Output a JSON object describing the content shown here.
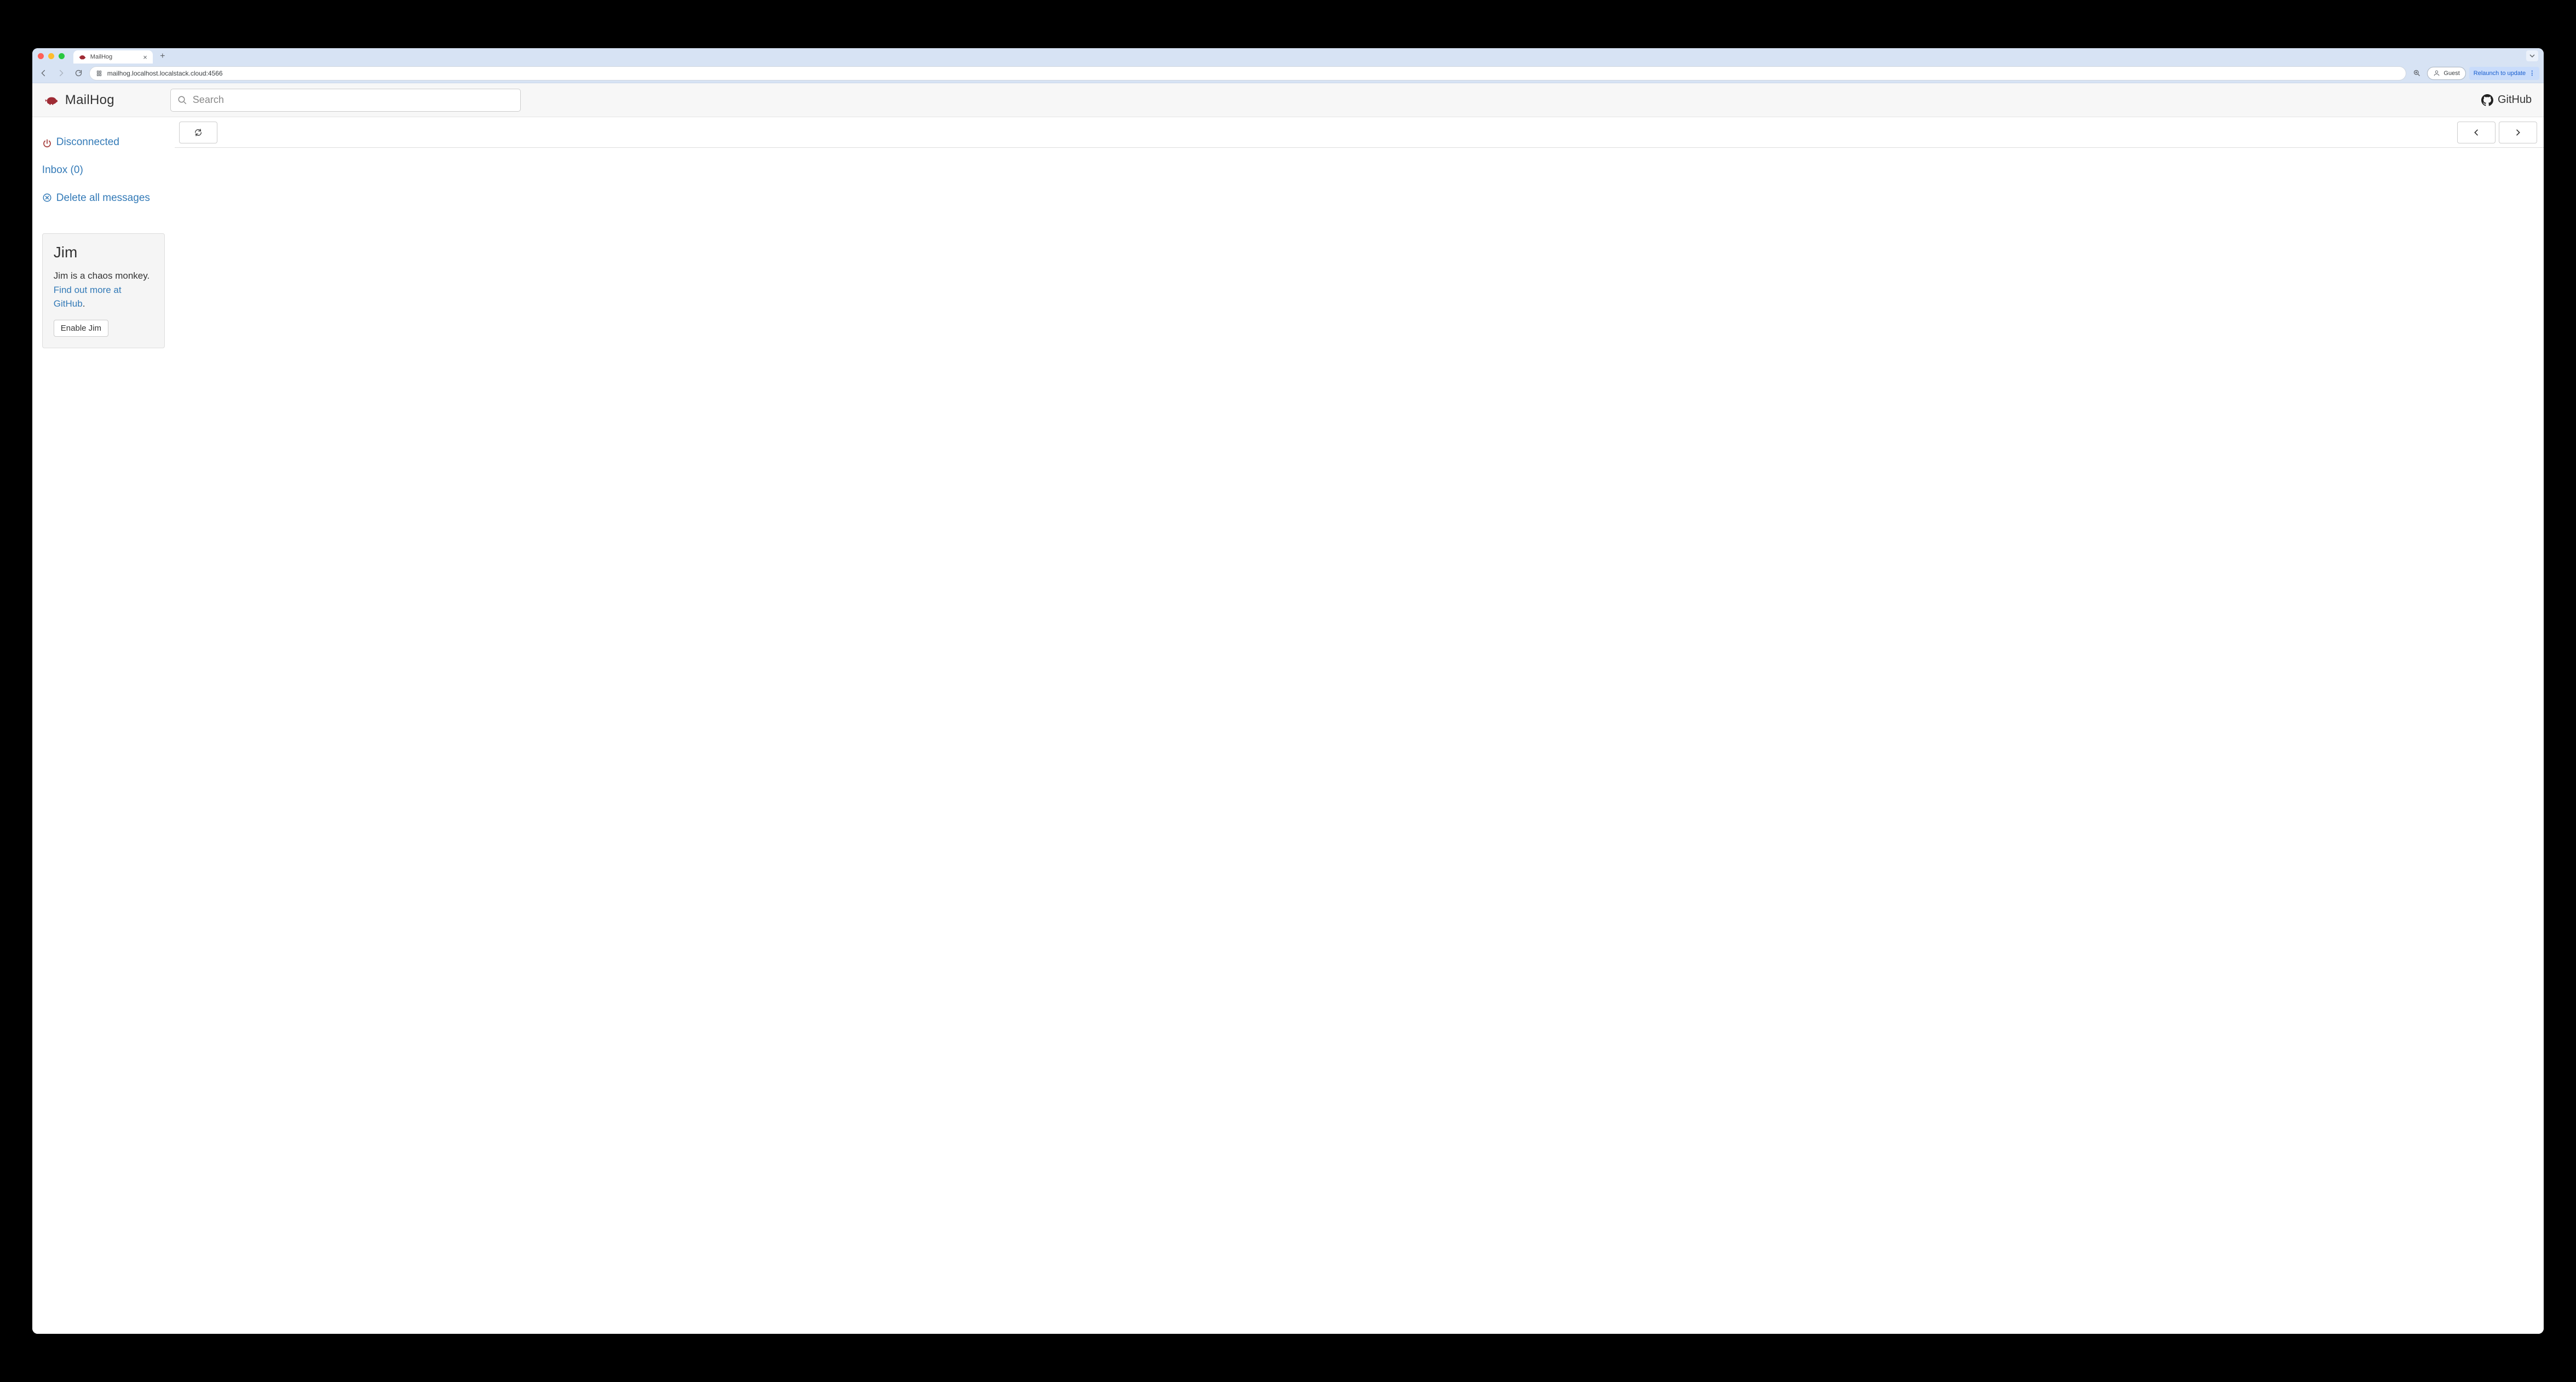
{
  "browser": {
    "tab_title": "MailHog",
    "url": "mailhog.localhost.localstack.cloud:4566",
    "guest_label": "Guest",
    "relaunch_label": "Relaunch to update"
  },
  "header": {
    "brand": "MailHog",
    "search_placeholder": "Search",
    "github_label": "GitHub"
  },
  "sidebar": {
    "connection_status": "Disconnected",
    "inbox_label": "Inbox (0)",
    "delete_label": "Delete all messages"
  },
  "jim": {
    "title": "Jim",
    "desc_text": "Jim is a chaos monkey.",
    "link_text": "Find out more at GitHub",
    "trailing_period": ".",
    "enable_button": "Enable Jim"
  }
}
